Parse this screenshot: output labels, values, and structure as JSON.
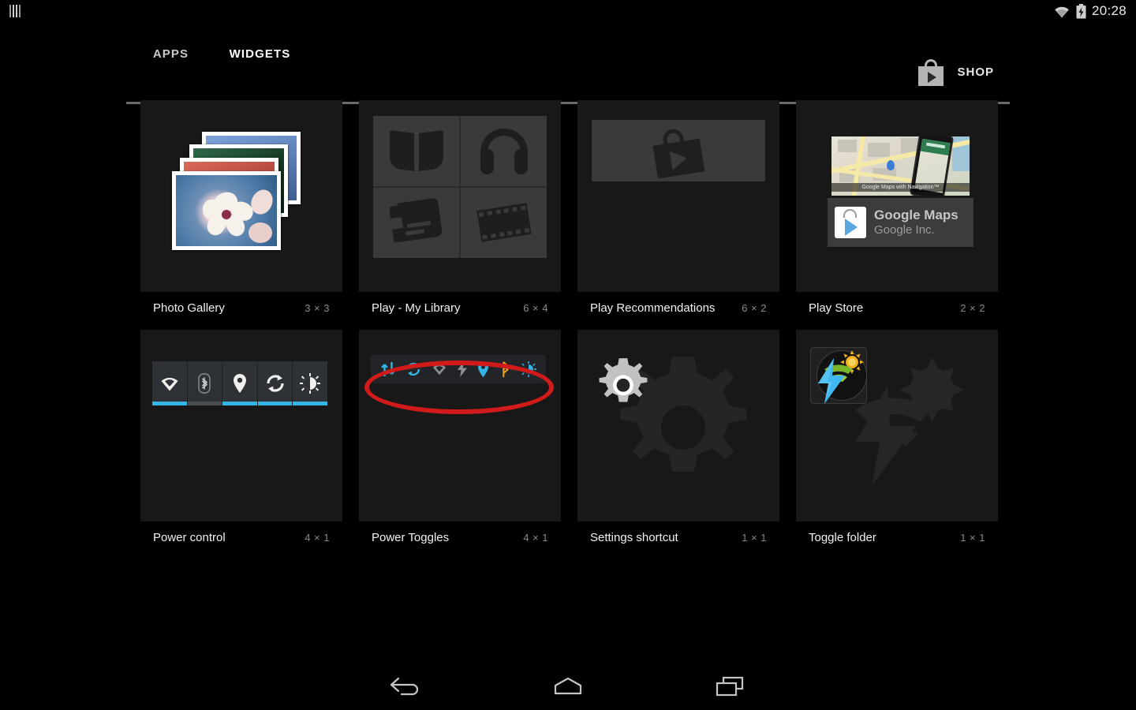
{
  "statusbar": {
    "notification_icon": "bars-icon",
    "wifi_icon": "wifi-icon",
    "battery_icon": "battery-charging-icon",
    "clock": "20:28"
  },
  "header": {
    "tabs": [
      {
        "label": "APPS",
        "active": false
      },
      {
        "label": "WIDGETS",
        "active": true
      }
    ],
    "shop": {
      "label": "SHOP",
      "icon": "play-store-bag-icon"
    }
  },
  "widgets": [
    {
      "name": "Photo Gallery",
      "size": "3 × 3",
      "preview": "photo-stack-preview"
    },
    {
      "name": "Play - My Library",
      "size": "6 × 4",
      "preview": "play-library-quad-preview"
    },
    {
      "name": "Play Recommendations",
      "size": "6 × 2",
      "preview": "play-bag-banner-preview"
    },
    {
      "name": "Play Store",
      "size": "2 × 2",
      "preview": "play-store-card-preview"
    },
    {
      "name": "Power control",
      "size": "4 × 1",
      "preview": "power-control-preview"
    },
    {
      "name": "Power Toggles",
      "size": "4 × 1",
      "preview": "power-toggles-preview"
    },
    {
      "name": "Settings shortcut",
      "size": "1 × 1",
      "preview": "settings-gear-preview"
    },
    {
      "name": "Toggle folder",
      "size": "1 × 1",
      "preview": "toggle-folder-preview"
    }
  ],
  "play_store_card": {
    "app_title": "Google Maps",
    "developer": "Google Inc.",
    "screenshot_caption": "Google Maps with Navigation™"
  },
  "power_control": {
    "toggles": [
      {
        "icon": "wifi-icon",
        "state": "on"
      },
      {
        "icon": "bluetooth-icon",
        "state": "off"
      },
      {
        "icon": "location-icon",
        "state": "on"
      },
      {
        "icon": "sync-icon",
        "state": "on"
      },
      {
        "icon": "brightness-icon",
        "state": "on"
      }
    ]
  },
  "power_toggles": {
    "toggles": [
      {
        "icon": "mobile-data-icon",
        "state": "on"
      },
      {
        "icon": "sync-icon",
        "state": "on"
      },
      {
        "icon": "wifi-icon",
        "state": "off"
      },
      {
        "icon": "flash-icon",
        "state": "off"
      },
      {
        "icon": "location-icon",
        "state": "on"
      },
      {
        "icon": "bluetooth-icon",
        "state": "on-alt"
      },
      {
        "icon": "brightness-icon",
        "state": "on"
      }
    ]
  },
  "annotation": {
    "shape": "red-ellipse",
    "target": "Power Toggles"
  },
  "navbar": {
    "buttons": [
      {
        "label": "Back",
        "icon": "back-arrow-icon"
      },
      {
        "label": "Home",
        "icon": "home-icon"
      },
      {
        "label": "Recents",
        "icon": "recents-icon"
      }
    ]
  },
  "colors": {
    "page_background": "#000000",
    "tile_background": "#181818",
    "accent_blue": "#33b5e5",
    "accent_orange": "#f0a020",
    "annotation_red": "#d11a1a",
    "active_tab_underline": "#ffffff"
  }
}
